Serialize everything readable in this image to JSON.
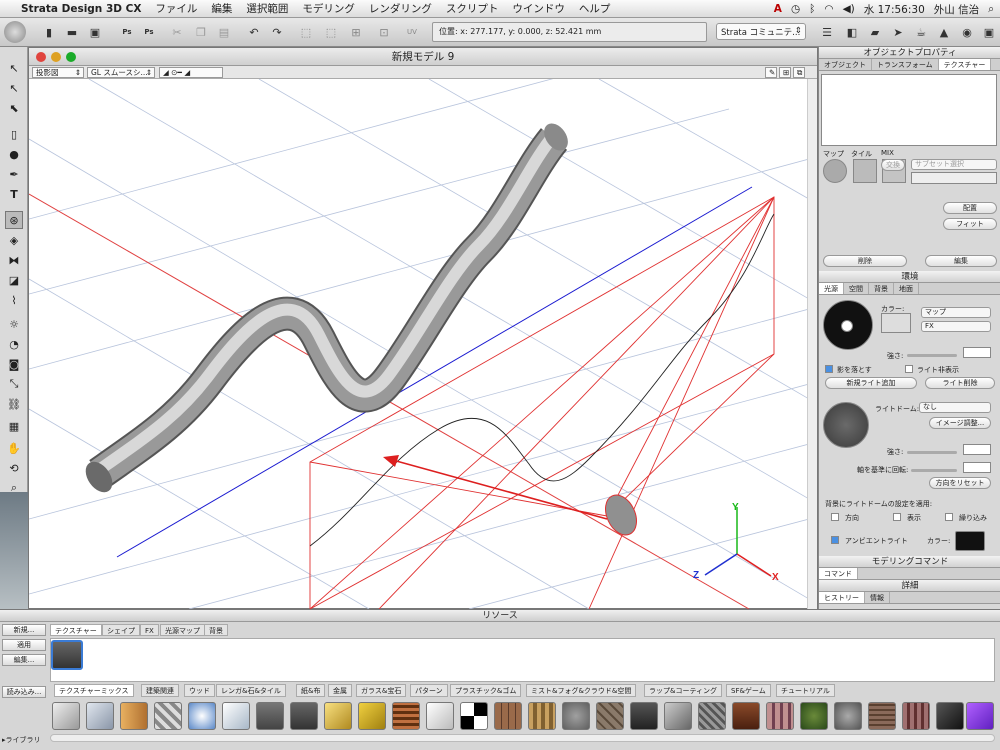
{
  "menubar": {
    "app": "Strata Design 3D CX",
    "items": [
      "ファイル",
      "編集",
      "選択範囲",
      "モデリング",
      "レンダリング",
      "スクリプト",
      "ウインドウ",
      "ヘルプ"
    ],
    "clock": "水 17:56:30",
    "user": "外山 信治"
  },
  "toolbar": {
    "coords": "位置: x: 277.177, y: 0.000, z: 52.421 mm",
    "community": "Strata コミュニテ..."
  },
  "model_window": {
    "title": "新規モデル 9",
    "projection": "投影図",
    "shading": "GL スムースシ..."
  },
  "axes": {
    "x": "X",
    "y": "Y",
    "z": "Z"
  },
  "obj_panel": {
    "title": "オブジェクトプロパティ",
    "tabs": [
      "オブジェクト",
      "トランスフォーム",
      "テクスチャー"
    ],
    "col_labels": [
      "マップ",
      "タイル",
      "MIX"
    ],
    "swap": "交換",
    "subset": "サブセット選択",
    "place": "配置",
    "fit": "フィット",
    "delete": "削除",
    "edit": "編集"
  },
  "env_panel": {
    "title": "環境",
    "tabs": [
      "光源",
      "空間",
      "背景",
      "地面"
    ],
    "color_label": "カラー:",
    "map": "マップ",
    "fx": "FX",
    "strength": "強さ:",
    "shadow": "影を落とす",
    "hide_light": "ライト非表示",
    "add_light": "新規ライト追加",
    "del_light": "ライト削除",
    "dome_label": "ライトドーム:",
    "dome_value": "なし",
    "image_adjust": "イメージ調整...",
    "rotate": "軸を基準に回転:",
    "reset_dir": "方向をリセット",
    "apply_text": "背景にライトドームの設定を適用:",
    "opt_dir": "方向",
    "opt_show": "表示",
    "opt_repeat": "繰り込み",
    "ambient": "アンビエントライト",
    "ambient_color": "カラー:"
  },
  "modeling": {
    "title": "モデリングコマンド",
    "tab": "コマンド"
  },
  "details": {
    "title": "詳細",
    "tabs": [
      "ヒストリー",
      "情報"
    ]
  },
  "resources": {
    "title": "リソース",
    "tabs": [
      "テクスチャー",
      "シェイプ",
      "FX",
      "光源マップ",
      "背景"
    ],
    "btn_new": "新規...",
    "btn_apply": "適用",
    "btn_edit": "編集...",
    "btn_load": "読み込み...",
    "library": "ライブラリ",
    "categories": [
      "テクスチャーミックス",
      "建築関連",
      "ウッド",
      "レンガ&石&タイル",
      "紙&布",
      "金属",
      "ガラス&宝石",
      "パターン",
      "プラスチック&ゴム",
      "ミスト&フォグ&クラウド&空間",
      "ラップ&コーティング",
      "SF&ゲーム",
      "チュートリアル"
    ]
  }
}
